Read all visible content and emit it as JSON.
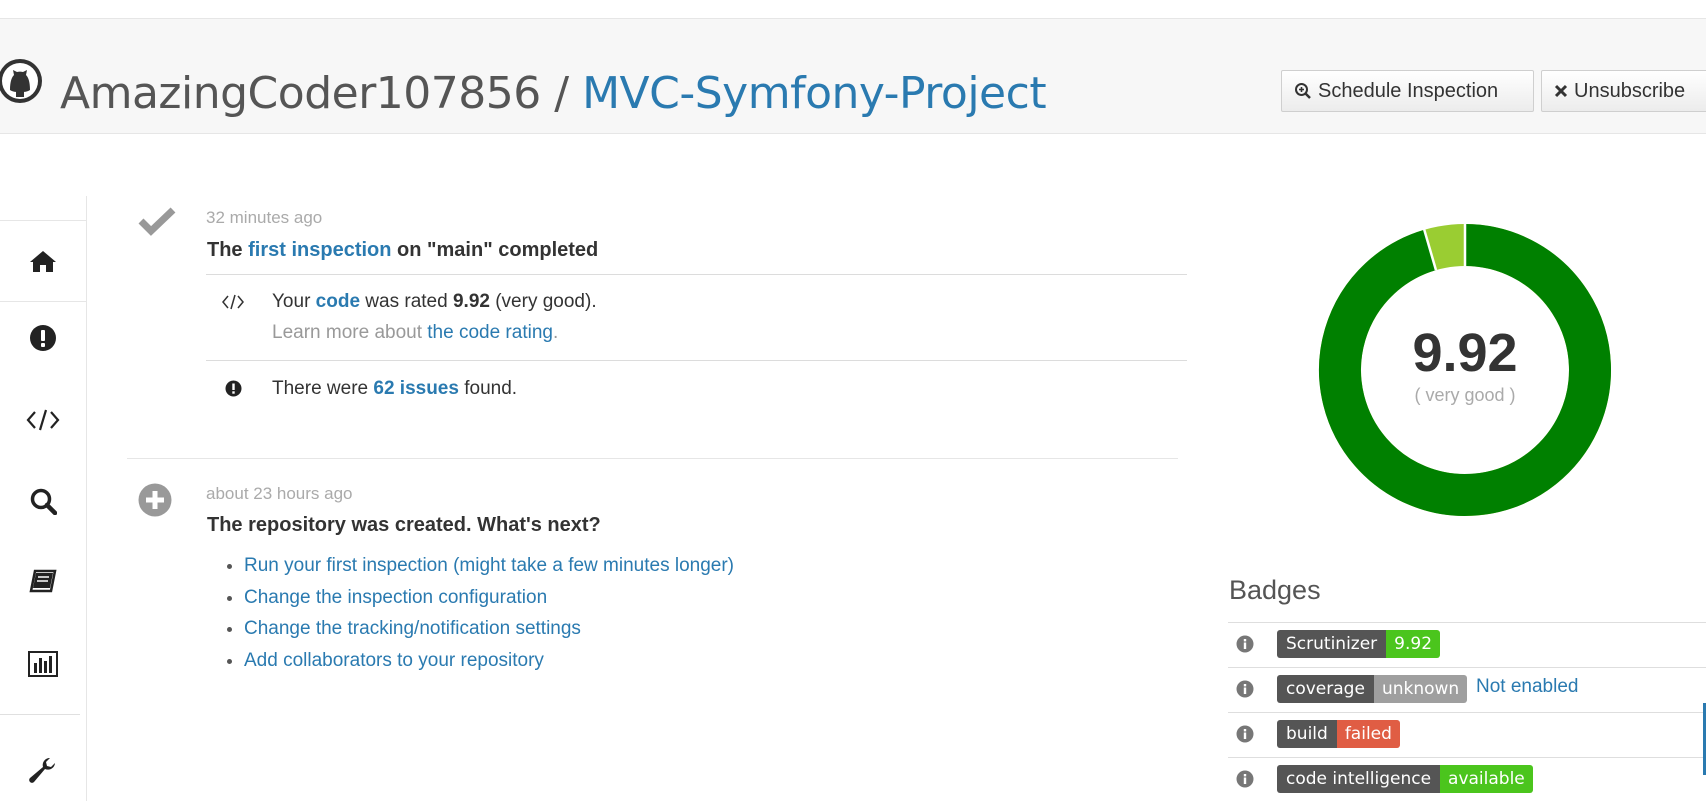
{
  "header": {
    "owner": "AmazingCoder107856",
    "separator": "/",
    "repo": "MVC-Symfony-Project",
    "schedule_label": "Schedule Inspection",
    "unsubscribe_label": "Unsubscribe"
  },
  "sidebar": {
    "items": [
      {
        "icon": "home-icon"
      },
      {
        "icon": "issues-icon"
      },
      {
        "icon": "code-icon"
      },
      {
        "icon": "search-icon"
      },
      {
        "icon": "book-icon"
      },
      {
        "icon": "stats-icon"
      },
      {
        "icon": "wrench-icon"
      }
    ]
  },
  "events": {
    "inspection": {
      "time": "32 minutes ago",
      "title_prefix": "The ",
      "title_link": "first inspection",
      "title_suffix": " on \"main\" completed",
      "rating_prefix": "Your ",
      "rating_link": "code",
      "rating_middle": " was rated ",
      "rating_value": "9.92",
      "rating_suffix": " (very good).",
      "learn_prefix": "Learn more about ",
      "learn_link": "the code rating",
      "learn_suffix": ".",
      "issues_prefix": "There were ",
      "issues_link": "62 issues",
      "issues_suffix": " found."
    },
    "created": {
      "time": "about 23 hours ago",
      "title": "The repository was created. What's next?",
      "next_steps": [
        "Run your first inspection (might take a few minutes longer)",
        "Change the inspection configuration",
        "Change the tracking/notification settings",
        "Add collaborators to your repository"
      ]
    }
  },
  "score": {
    "value": "9.92",
    "label": "( very good )",
    "fraction": 0.955,
    "color_good": "#008000",
    "color_rest": "#9acd32"
  },
  "badges": {
    "title": "Badges",
    "items": [
      {
        "key": "Scrutinizer",
        "value": "9.92",
        "color": "#4bc51d",
        "note": ""
      },
      {
        "key": "coverage",
        "value": "unknown",
        "color": "#9f9f9f",
        "note": "Not enabled"
      },
      {
        "key": "build",
        "value": "failed",
        "color": "#e05d44",
        "note": ""
      },
      {
        "key": "code intelligence",
        "value": "available",
        "color": "#4bc51d",
        "note": ""
      }
    ]
  }
}
